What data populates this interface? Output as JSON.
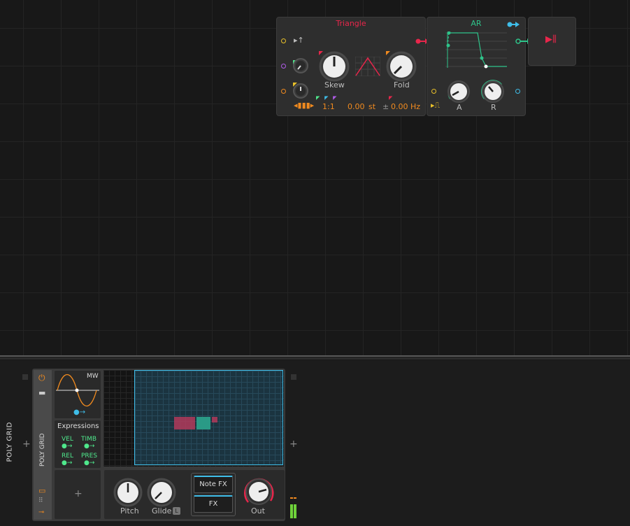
{
  "triangle_module": {
    "title": "Triangle",
    "skew_label": "Skew",
    "fold_label": "Fold",
    "ratio": "1:1",
    "semitones_value": "0.00",
    "semitones_unit": "st",
    "hz_prefix": "±",
    "hz_value": "0.00 Hz"
  },
  "ar_module": {
    "title": "AR",
    "attack_label": "A",
    "release_label": "R"
  },
  "device": {
    "side_label": "POLY GRID",
    "vertical_label": "POLY GRID",
    "mw_label": "MW",
    "expressions_title": "Expressions",
    "expressions": [
      "VEL",
      "TIMB",
      "REL",
      "PRES"
    ],
    "pitch_label": "Pitch",
    "glide_label": "Glide",
    "glide_badge": "L",
    "note_fx_label": "Note FX",
    "fx_label": "FX",
    "out_label": "Out",
    "add_symbol": "+"
  },
  "colors": {
    "accent_red": "#e8264b",
    "accent_green": "#2ec48a",
    "accent_orange": "#f08a1f",
    "accent_blue": "#3fbde8"
  }
}
